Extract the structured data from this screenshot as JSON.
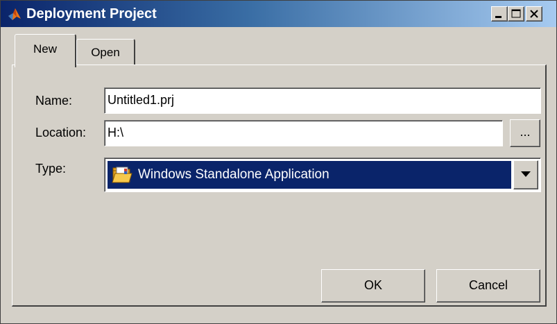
{
  "window": {
    "title": "Deployment Project",
    "icon": "matlab-logo-icon",
    "controls": [
      "minimize-icon",
      "maximize-icon",
      "close-icon"
    ]
  },
  "tabs": [
    {
      "label": "New",
      "selected": true
    },
    {
      "label": "Open",
      "selected": false
    }
  ],
  "form": {
    "name_label": "Name:",
    "name_value": "Untitled1.prj",
    "location_label": "Location:",
    "location_value": "H:\\",
    "browse_label": "...",
    "type_label": "Type:",
    "type_value": "Windows Standalone Application",
    "type_icon": "folder-open-icon"
  },
  "buttons": {
    "ok": "OK",
    "cancel": "Cancel"
  },
  "colors": {
    "selection": "#0a246a",
    "face": "#d4d0c8"
  }
}
